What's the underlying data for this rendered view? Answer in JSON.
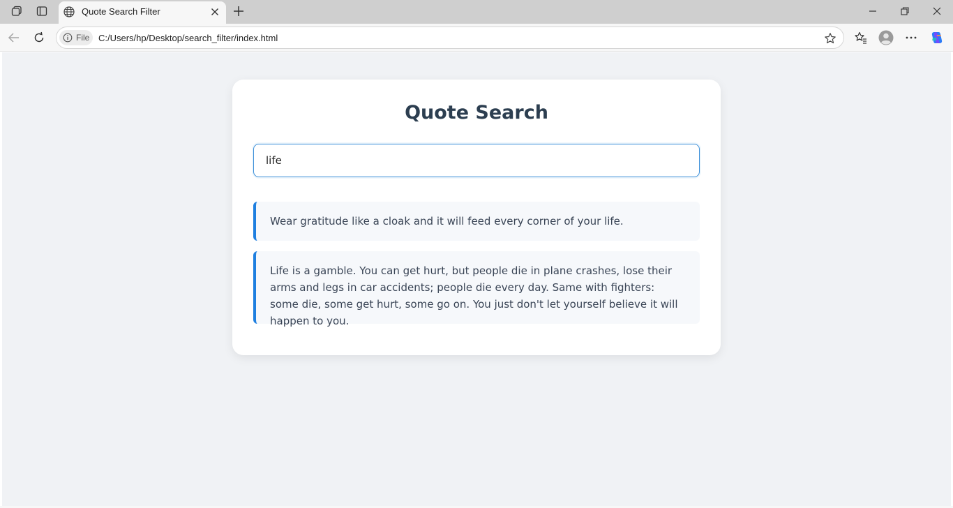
{
  "browser": {
    "tab_title": "Quote Search Filter",
    "site_chip_label": "File",
    "url": "C:/Users/hp/Desktop/search_filter/index.html",
    "icons": {
      "workspaces": "workspaces-icon",
      "tab_actions": "tab-actions-icon",
      "favicon": "globe-icon",
      "close_tab": "close-icon",
      "new_tab": "plus-icon",
      "minimize": "minimize-icon",
      "restore": "restore-icon",
      "close_window": "close-icon",
      "back": "back-arrow-icon",
      "refresh": "refresh-icon",
      "info": "info-icon",
      "favorite": "star-icon",
      "favorites": "favorites-icon",
      "profile": "avatar-icon",
      "more": "more-icon",
      "copilot": "copilot-icon"
    }
  },
  "page": {
    "title": "Quote Search",
    "search": {
      "value": "life",
      "focused": true
    },
    "quotes": [
      "Wear gratitude like a cloak and it will feed every corner of your life.",
      "Life is a gamble. You can get hurt, but people die in plane crashes, lose their arms and legs in car accidents; people die every day. Same with fighters: some die, some get hurt, some go on. You just don't let yourself believe it will happen to you."
    ]
  },
  "colors": {
    "page_background": "#f0f2f5",
    "card_background": "#ffffff",
    "title_text": "#2c3e50",
    "input_border_focus": "#3d8fd9",
    "quote_accent": "#1e7fe0",
    "quote_background": "#f6f8fb",
    "quote_text": "#3a4556"
  }
}
